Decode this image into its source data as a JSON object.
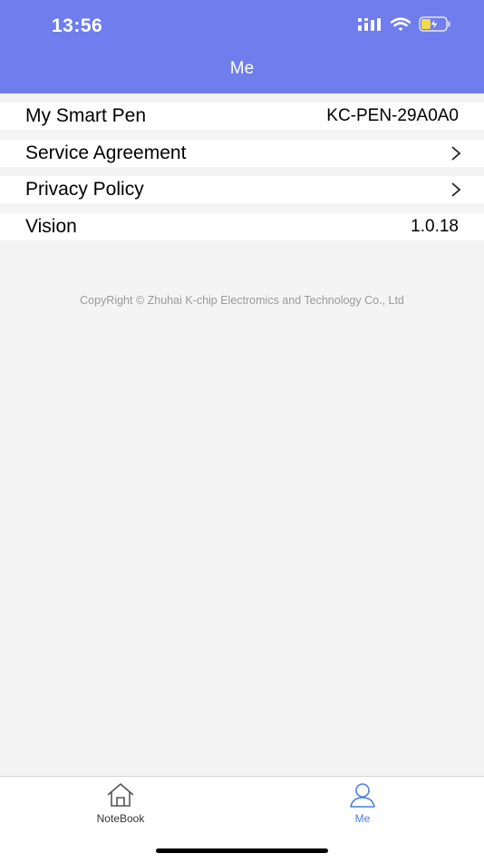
{
  "status_bar": {
    "time": "13:56",
    "icons": [
      "signal-icon",
      "wifi-icon",
      "battery-charging-icon"
    ]
  },
  "header": {
    "title": "Me",
    "background": "#6f7ded"
  },
  "settings": {
    "rows": [
      {
        "label": "My Smart Pen",
        "value": "KC-PEN-29A0A0"
      },
      {
        "label": "Service Agreement",
        "icon": "chevron-right-icon"
      },
      {
        "label": "Privacy Policy",
        "icon": "chevron-right-icon"
      },
      {
        "label": "Vision",
        "value": "1.0.18"
      }
    ]
  },
  "footer": {
    "copyright": "CopyRight © Zhuhai K-chip Electromics and Technology Co., Ltd"
  },
  "tabbar": {
    "tabs": [
      {
        "label": "NoteBook",
        "icon": "home-icon",
        "active": false
      },
      {
        "label": "Me",
        "icon": "person-icon",
        "active": true
      }
    ],
    "active_color": "#4a7fe0",
    "inactive_color": "#333333"
  }
}
